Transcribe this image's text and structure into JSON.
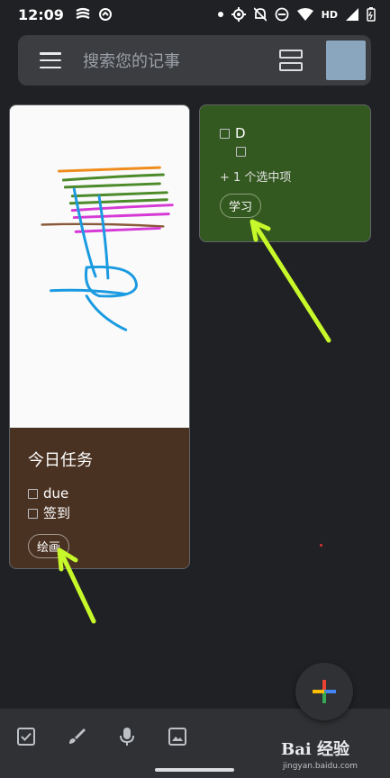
{
  "status": {
    "time": "12:09",
    "hd": "HD"
  },
  "search": {
    "placeholder": "搜索您的记事"
  },
  "notes": [
    {
      "title": "今日任务",
      "items": [
        "due",
        "签到"
      ],
      "label": "绘画",
      "color": "#4a3222"
    },
    {
      "items": [
        "D",
        ""
      ],
      "more": "+ 1 个选中项",
      "label": "学习",
      "color": "#345920"
    }
  ],
  "watermark": {
    "brand": "Bai 经验",
    "url": "jingyan.baidu.com"
  },
  "colors": {
    "background": "#202124",
    "annotation_arrow": "#c6f82a"
  }
}
